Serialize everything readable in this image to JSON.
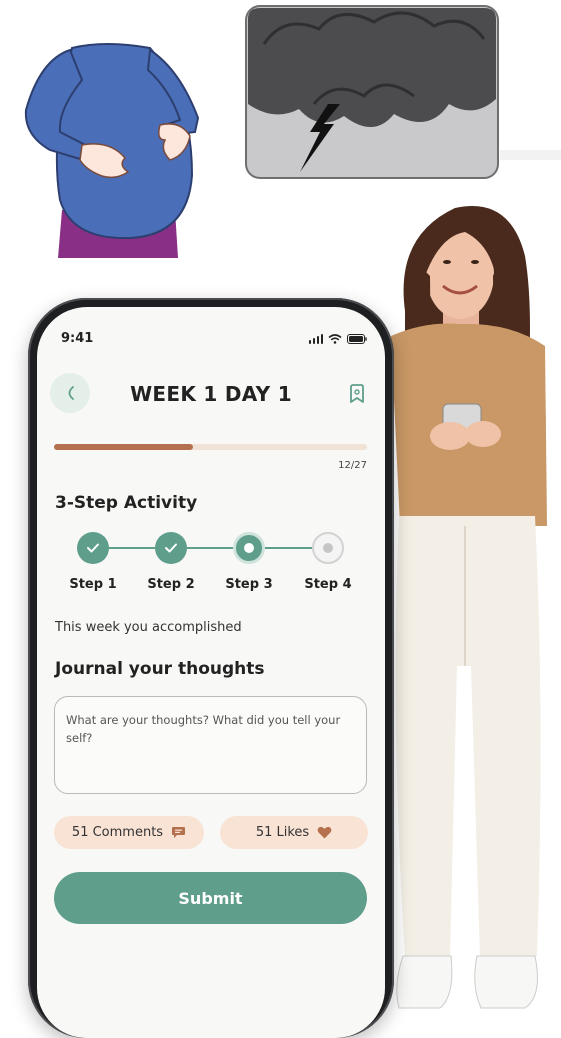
{
  "status": {
    "time": "9:41"
  },
  "header": {
    "title": "WEEK 1 DAY 1"
  },
  "progress": {
    "current": 12,
    "total": 27,
    "label": "12/27"
  },
  "activity": {
    "title": "3-Step Activity",
    "steps": [
      {
        "label": "Step 1",
        "state": "done"
      },
      {
        "label": "Step 2",
        "state": "done"
      },
      {
        "label": "Step 3",
        "state": "current"
      },
      {
        "label": "Step 4",
        "state": "todo"
      }
    ]
  },
  "summary": {
    "text": "This week you accomplished"
  },
  "journal": {
    "title": "Journal your thoughts",
    "placeholder": "What are your thoughts? What did you tell your self?"
  },
  "social": {
    "comments_label": "51 Comments",
    "likes_label": "51 Likes"
  },
  "actions": {
    "submit_label": "Submit"
  },
  "colors": {
    "accent": "#5f9e8b",
    "progress": "#b5714e",
    "chip": "#f9e3d5"
  }
}
